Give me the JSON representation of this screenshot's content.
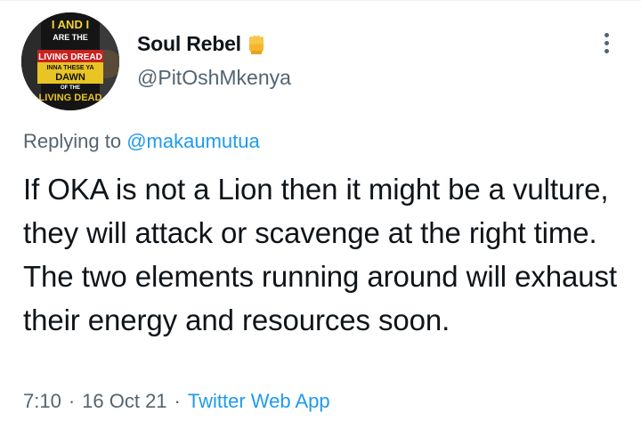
{
  "user": {
    "display_name": "Soul Rebel",
    "handle": "@PitOshMkenya",
    "avatar_text": {
      "line1": "I AND I",
      "line2": "ARE THE",
      "line3": "LIVING DREAD",
      "line4": "INNA THESE YA",
      "line5": "DAWN",
      "line6": "OF THE",
      "line7": "LIVING DEAD"
    },
    "badge_icon": "raised-fist-icon"
  },
  "reply": {
    "prefix": "Replying to",
    "mention": "@makaumutua"
  },
  "tweet": {
    "text": "If OKA is not a Lion then it might be a vulture, they will attack or scavenge at the right time. The two elements running around will exhaust their energy and resources soon."
  },
  "meta": {
    "time": "7:10",
    "sep1": "·",
    "date": "16 Oct 21",
    "sep2": "·",
    "source": "Twitter Web App"
  },
  "colors": {
    "accent": "#1d9bf0",
    "secondary_text": "#536471",
    "primary_text": "#0f1419"
  }
}
